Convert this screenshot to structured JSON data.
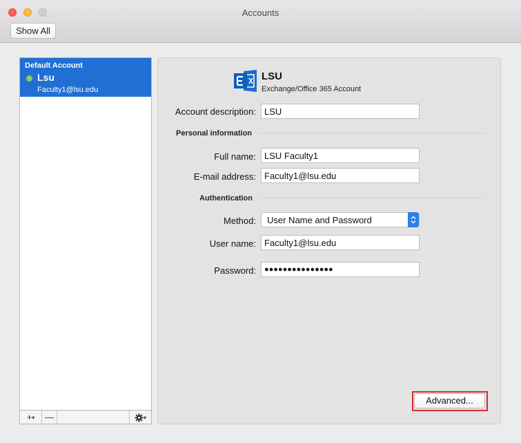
{
  "window": {
    "title": "Accounts",
    "show_all_label": "Show All"
  },
  "sidebar": {
    "accounts": [
      {
        "heading": "Default Account",
        "name": "Lsu",
        "email": "Faculty1@lsu.edu",
        "status_color": "#7fd16a"
      }
    ],
    "toolbar": {
      "add_label": "+",
      "remove_label": "—",
      "chevron": "▾",
      "gear_icon": "gear-icon"
    }
  },
  "account": {
    "name": "LSU",
    "type": "Exchange/Office 365 Account",
    "icon": "exchange-icon",
    "description_label": "Account description:",
    "description_value": "LSU"
  },
  "personal": {
    "section_label": "Personal information",
    "full_name_label": "Full name:",
    "full_name_value": "LSU Faculty1",
    "email_label": "E-mail address:",
    "email_value": "Faculty1@lsu.edu"
  },
  "auth": {
    "section_label": "Authentication",
    "method_label": "Method:",
    "method_value": "User Name and Password",
    "username_label": "User name:",
    "username_value": "Faculty1@lsu.edu",
    "password_label": "Password:",
    "password_value": "●●●●●●●●●●●●●●●"
  },
  "footer": {
    "advanced_label": "Advanced..."
  },
  "colors": {
    "selection": "#1f6fd5",
    "accent": "#2f7fe6",
    "highlight": "#e0262b"
  }
}
